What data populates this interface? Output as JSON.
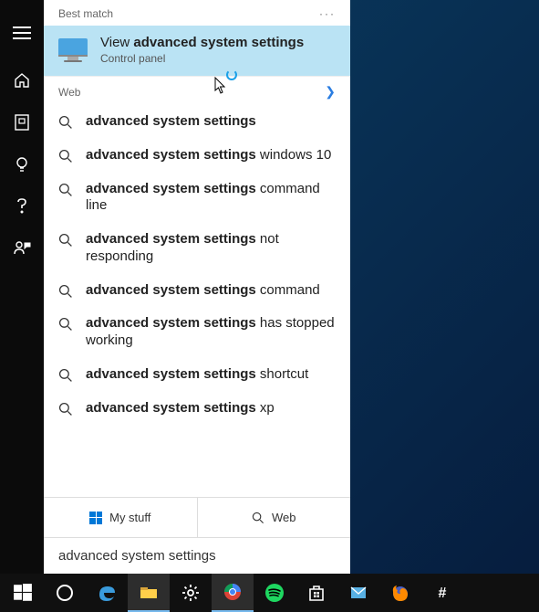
{
  "header": {
    "best_match": "Best match",
    "web": "Web"
  },
  "best_match": {
    "prefix": "View ",
    "bold": "advanced system settings",
    "subtitle": "Control panel"
  },
  "results": [
    {
      "bold": "advanced system settings",
      "rest": ""
    },
    {
      "bold": "advanced system settings",
      "rest": " windows 10"
    },
    {
      "bold": "advanced system settings",
      "rest": " command line"
    },
    {
      "bold": "advanced system settings",
      "rest": " not responding"
    },
    {
      "bold": "advanced system settings",
      "rest": " command"
    },
    {
      "bold": "advanced system settings",
      "rest": " has stopped working"
    },
    {
      "bold": "advanced system settings",
      "rest": " shortcut"
    },
    {
      "bold": "advanced system settings",
      "rest": " xp"
    }
  ],
  "tabs": {
    "mystuff": "My stuff",
    "web": "Web"
  },
  "search": {
    "query": "advanced system settings"
  },
  "taskbar": [
    {
      "name": "start",
      "color": "#ffffff"
    },
    {
      "name": "cortana",
      "color": "#ffffff"
    },
    {
      "name": "edge",
      "color": "#3a9bdc"
    },
    {
      "name": "explorer",
      "color": "#ffcf4a"
    },
    {
      "name": "settings",
      "color": "#ffffff"
    },
    {
      "name": "chrome",
      "color": "#f1c94b"
    },
    {
      "name": "spotify",
      "color": "#1ed760"
    },
    {
      "name": "store",
      "color": "#ffffff"
    },
    {
      "name": "mail",
      "color": "#58b0e3"
    },
    {
      "name": "firefox",
      "color": "#ff8a00"
    },
    {
      "name": "slack",
      "color": "#ffffff"
    }
  ]
}
